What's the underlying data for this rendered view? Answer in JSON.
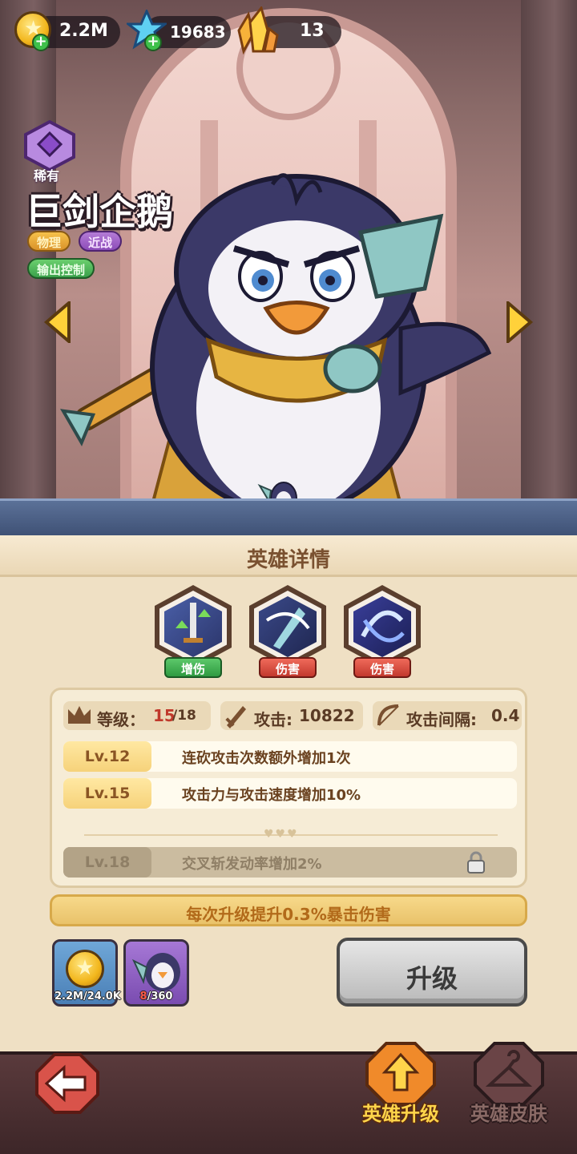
{
  "currency": {
    "gold": "2.2M",
    "gems": "19683",
    "crystals": "13"
  },
  "hero": {
    "rarity": "稀有",
    "name": "巨剑企鹅",
    "tags": [
      "物理",
      "近战",
      "输出控制"
    ]
  },
  "panel": {
    "title": "英雄详情",
    "skills": [
      {
        "tag": "增伤",
        "tag_color": "#3aa14b",
        "icon": "sword-buff-icon"
      },
      {
        "tag": "伤害",
        "tag_color": "#c2392e",
        "icon": "sword-slash-icon"
      },
      {
        "tag": "伤害",
        "tag_color": "#c2392e",
        "icon": "whirlwind-icon"
      }
    ],
    "stats": {
      "level_label": "等级：",
      "level_current": "15",
      "level_max": "/18",
      "attack_label": "攻击:",
      "attack_value": "10822",
      "interval_label": "攻击间隔:",
      "interval_value": "0.4"
    },
    "level_perks": [
      {
        "level": "Lv.12",
        "text": "连砍攻击次数额外增加1次",
        "locked": false
      },
      {
        "level": "Lv.15",
        "text": "攻击力与攻击速度增加10%",
        "locked": false
      },
      {
        "level": "Lv.18",
        "text": "交叉斩发动率增加2%",
        "locked": true
      }
    ],
    "bonus_text": "每次升级提升0.3%暴击伤害",
    "costs": {
      "gold_have": "2.2M",
      "gold_need": "/24.0K",
      "shard_have": "8",
      "shard_need": "/360"
    },
    "upgrade_label": "升级"
  },
  "nav": {
    "tabs": [
      {
        "label": "英雄升级",
        "active": true
      },
      {
        "label": "英雄皮肤",
        "active": false
      }
    ]
  },
  "colors": {
    "gold_text": "#ffd44a",
    "panel_bg": "#efe0c4",
    "accent_red": "#ff5a4a"
  }
}
